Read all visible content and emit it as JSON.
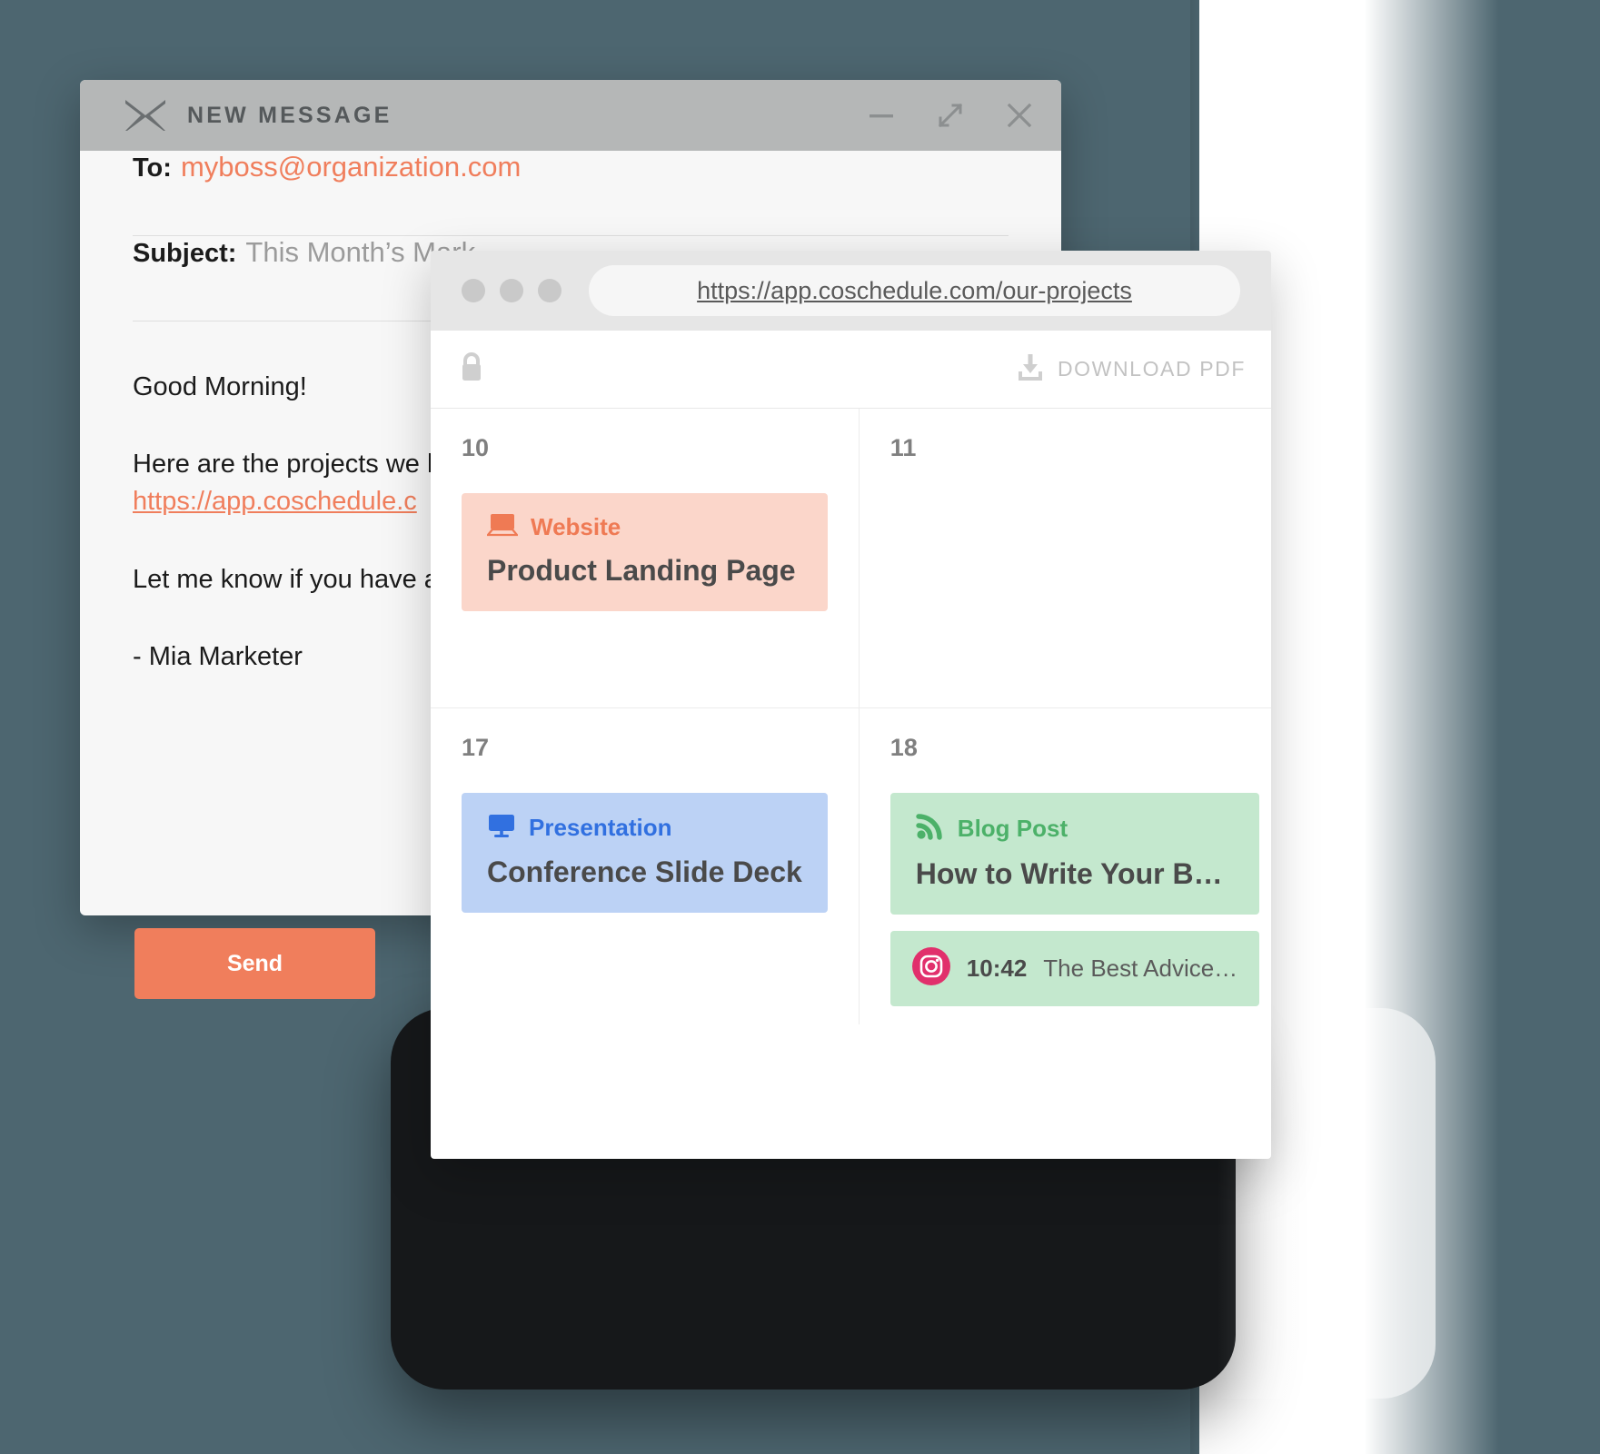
{
  "colors": {
    "page_background": "#4d6670",
    "accent_orange": "#f07e5c",
    "card_website_bg": "#fbd6ca",
    "card_website_fg": "#ef7a54",
    "card_presentation_bg": "#bcd2f5",
    "card_presentation_fg": "#3170e0",
    "card_blog_bg": "#c4e8ce",
    "card_blog_fg": "#4cb169",
    "instagram_pink": "#e1306c",
    "titlebar_gray": "#b5b7b7"
  },
  "email": {
    "title": "NEW MESSAGE",
    "title_icon": "envelope-icon",
    "controls": {
      "minimize": "minimize-icon",
      "expand": "expand-icon",
      "close": "close-icon"
    },
    "to": {
      "label": "To:",
      "value": "myboss@organization.com"
    },
    "subject": {
      "label": "Subject:",
      "value": "This Month’s Mark"
    },
    "body": {
      "greeting": "Good Morning!",
      "line_intro": "Here are the projects we have",
      "link": "https://app.coschedule.c",
      "line_followup": "Let me know if you have any",
      "signature": "- Mia Marketer"
    },
    "send_label": "Send"
  },
  "browser": {
    "dots": [
      "dot-1",
      "dot-2",
      "dot-3"
    ],
    "url": "https://app.coschedule.com/our-projects",
    "toolbar": {
      "lock_icon": "lock-icon",
      "download_icon": "download-icon",
      "download_label": "DOWNLOAD PDF"
    },
    "calendar": {
      "cells": [
        {
          "day": "10",
          "cards": [
            {
              "type_label": "Website",
              "type_icon": "laptop-icon",
              "style": "website",
              "title": "Product Landing Page"
            }
          ],
          "social": []
        },
        {
          "day": "11",
          "cards": [],
          "social": []
        },
        {
          "day": "17",
          "cards": [
            {
              "type_label": "Presentation",
              "type_icon": "monitor-icon",
              "style": "presentation",
              "title": "Conference Slide Deck"
            }
          ],
          "social": []
        },
        {
          "day": "18",
          "cards": [
            {
              "type_label": "Blog Post",
              "type_icon": "rss-icon",
              "style": "blog",
              "title": "How to Write Your B…"
            }
          ],
          "social": [
            {
              "icon": "instagram-icon",
              "time": "10:42",
              "title": "The Best Advice…"
            }
          ]
        }
      ]
    }
  }
}
